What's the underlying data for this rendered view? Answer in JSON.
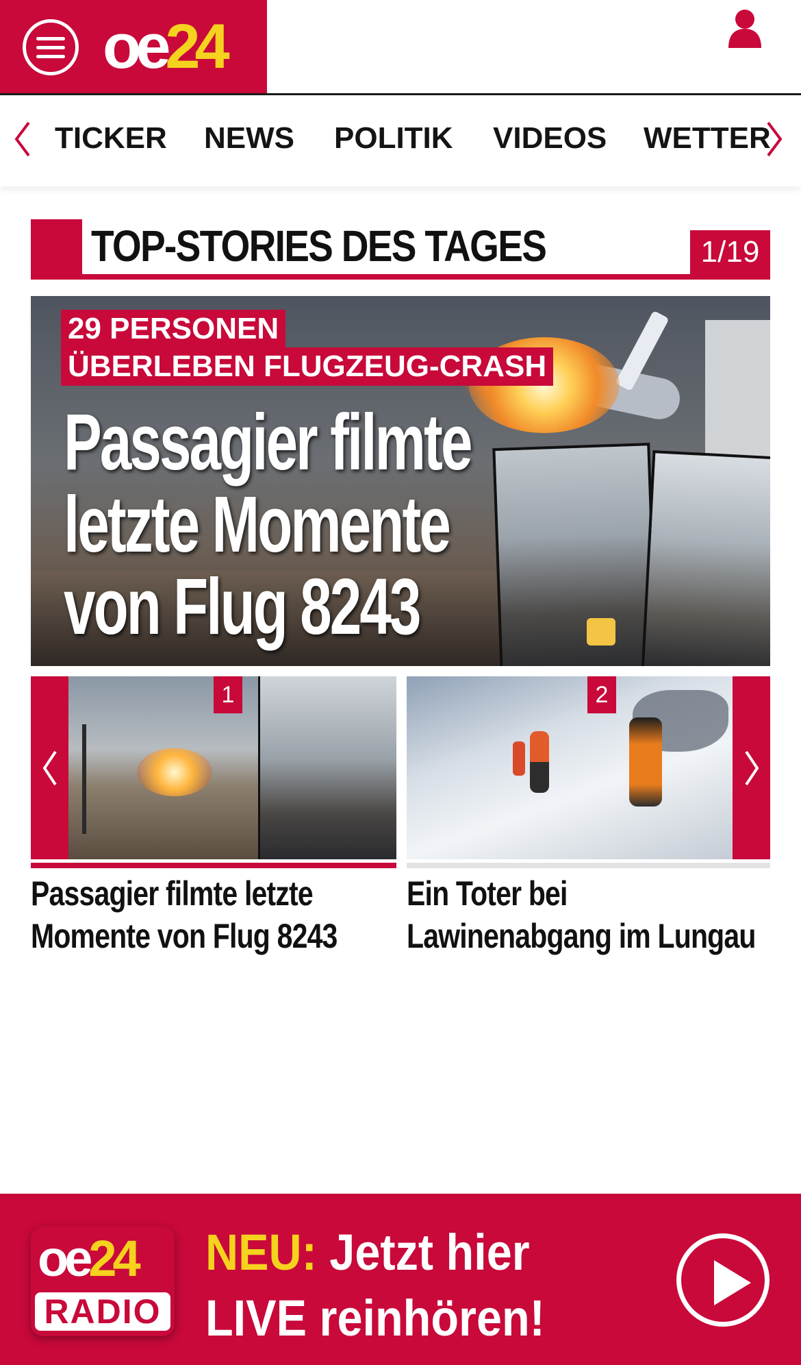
{
  "header": {
    "logo_oe": "oe",
    "logo_24": "24",
    "menu_icon": "hamburger-menu-icon",
    "user_icon": "user-icon"
  },
  "nav": {
    "items": [
      "TICKER",
      "NEWS",
      "POLITIK",
      "VIDEOS",
      "WETTER"
    ],
    "prev_icon": "chevron-left-icon",
    "next_icon": "chevron-right-icon"
  },
  "section": {
    "title": "TOP-STORIES DES TAGES",
    "counter": "1/19"
  },
  "hero": {
    "kicker_line1": "29 PERSONEN",
    "kicker_line2": "ÜBERLEBEN FLUGZEUG-CRASH",
    "headline_line1": "Passagier filmte",
    "headline_line2": "letzte Momente",
    "headline_line3": "von Flug 8243"
  },
  "carousel": {
    "cards": [
      {
        "number": "1",
        "title_line1": "Passagier filmte letzte",
        "title_line2": "Momente von Flug 8243"
      },
      {
        "number": "2",
        "title_line1": "Ein Toter bei",
        "title_line2": "Lawinenabgang im Lungau"
      }
    ],
    "active_index": 1
  },
  "radio": {
    "logo_oe": "oe",
    "logo_24": "24",
    "logo_radio": "RADIO",
    "highlight": "NEU:",
    "line1_rest": "Jetzt hier",
    "line2": "LIVE reinhören!",
    "play_icon": "play-icon"
  },
  "colors": {
    "brand_red": "#c8093a",
    "brand_yellow": "#f5d21e"
  }
}
